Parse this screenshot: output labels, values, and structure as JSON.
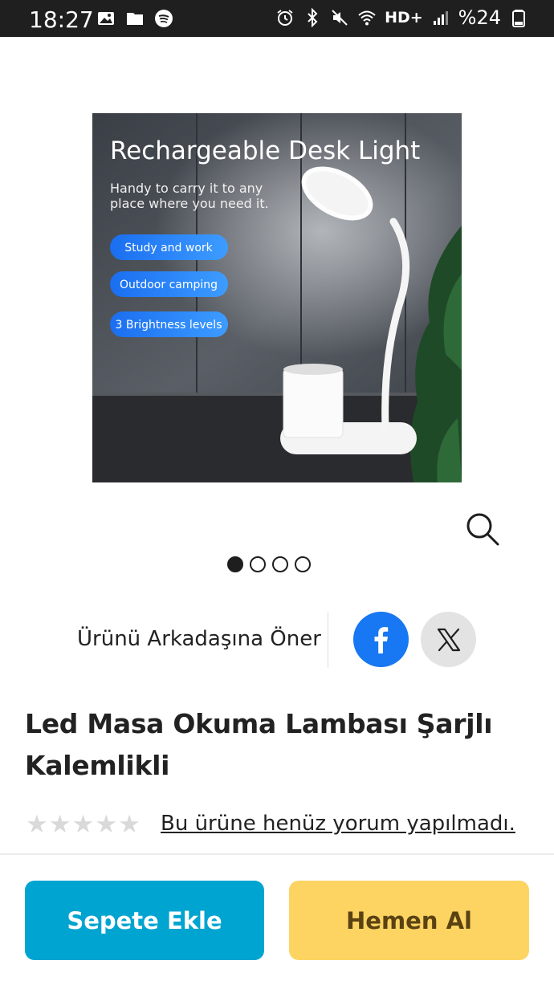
{
  "status_bar": {
    "time": "18:27",
    "network": "HD+",
    "battery": "%24"
  },
  "product": {
    "image": {
      "headline": "Rechargeable Desk Light",
      "subline_1": "Handy to carry it to any",
      "subline_2": "place where you need it.",
      "features": [
        "Study and work",
        "Outdoor camping",
        "3 Brightness levels"
      ]
    },
    "carousel": {
      "total": 4,
      "active": 1
    },
    "title": "Led Masa Okuma Lambası Şarjlı Kalemlikli",
    "rating": {
      "stars_filled": 0,
      "stars_total": 5
    },
    "review_text": "Bu ürüne henüz yorum yapılmadı."
  },
  "share": {
    "label": "Ürünü Arkadaşına Öner",
    "facebook_icon": "facebook-icon",
    "x_icon": "x-icon"
  },
  "actions": {
    "add_to_cart": "Sepete Ekle",
    "buy_now": "Hemen Al"
  },
  "colors": {
    "cart_button": "#00a4d0",
    "buy_button": "#fdd462",
    "facebook": "#1877f2"
  }
}
